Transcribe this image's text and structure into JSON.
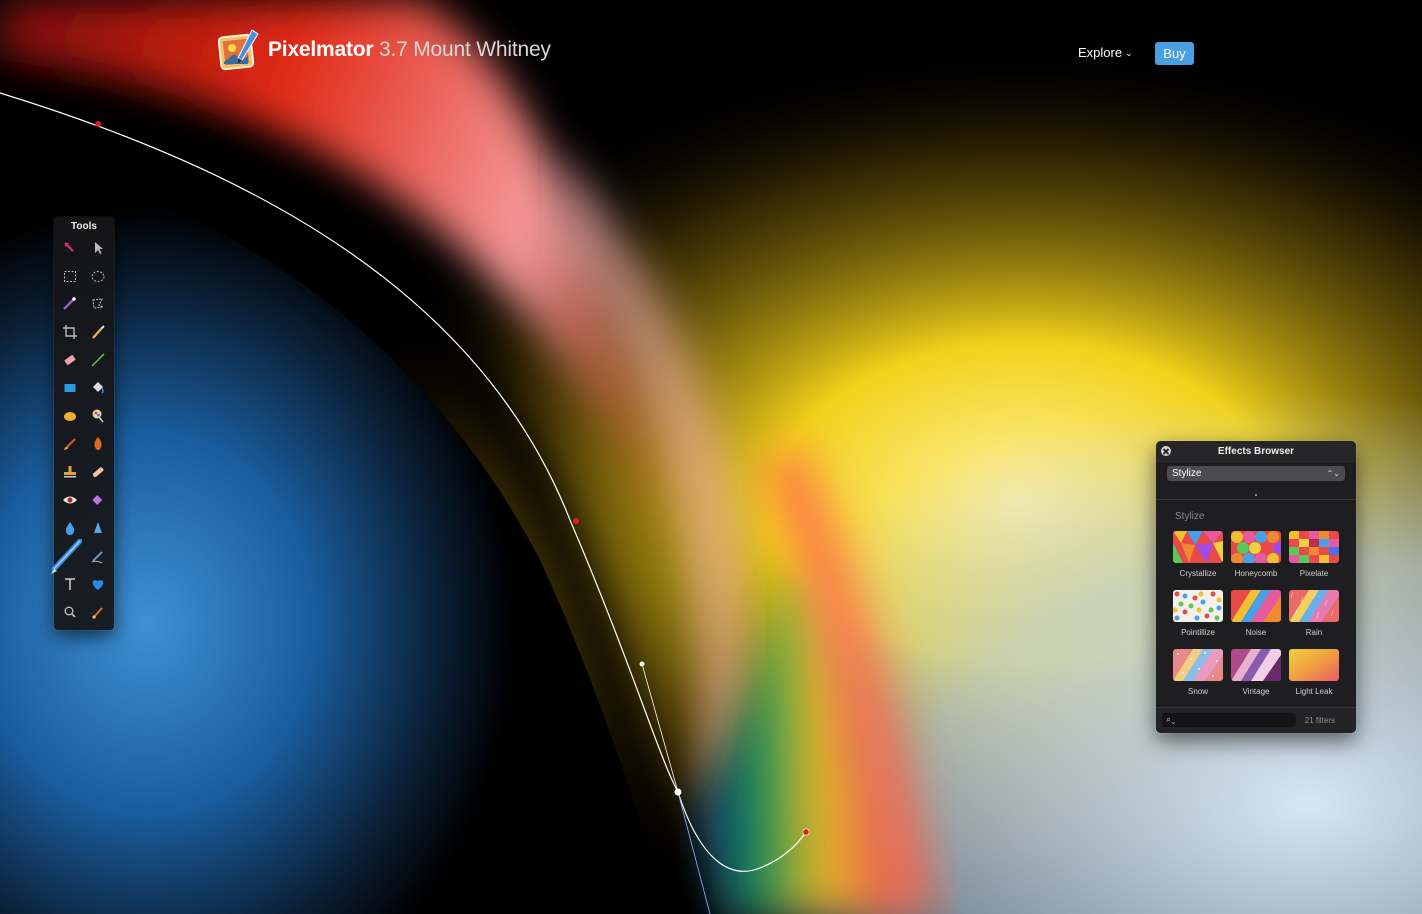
{
  "header": {
    "brand_name": "Pixelmator",
    "brand_version": "3.7 Mount Whitney",
    "nav_explore": "Explore",
    "buy_label": "Buy"
  },
  "colors": {
    "buy_button": "#4a9fe0",
    "panel_background": "#1e1e20",
    "curve_point": "#e02020"
  },
  "tools_palette": {
    "title": "Tools",
    "tools": [
      "arrange-icon",
      "move-icon",
      "rect-select-icon",
      "ellipse-select-icon",
      "magic-wand-icon",
      "lasso-icon",
      "crop-icon",
      "eyedropper-icon",
      "eraser-icon",
      "line-icon",
      "rectangle-icon",
      "paint-bucket-icon",
      "ellipse-shape-icon",
      "color-picker-icon",
      "brush-icon",
      "burn-icon",
      "stamp-icon",
      "bandage-icon",
      "red-eye-icon",
      "sharpen-icon",
      "blur-icon",
      "cone-icon",
      "pen-icon",
      "freeform-pen-icon",
      "type-icon",
      "heart-shape-icon",
      "zoom-icon",
      "smudge-icon"
    ]
  },
  "effects_browser": {
    "title": "Effects Browser",
    "category": "Stylize",
    "section_label": "Stylize",
    "effects": [
      {
        "label": "Crystallize"
      },
      {
        "label": "Honeycomb"
      },
      {
        "label": "Pixelate"
      },
      {
        "label": "Pointillize"
      },
      {
        "label": "Noise"
      },
      {
        "label": "Rain"
      },
      {
        "label": "Snow"
      },
      {
        "label": "Vintage"
      },
      {
        "label": "Light Leak"
      }
    ],
    "filter_count": "21 filters"
  }
}
